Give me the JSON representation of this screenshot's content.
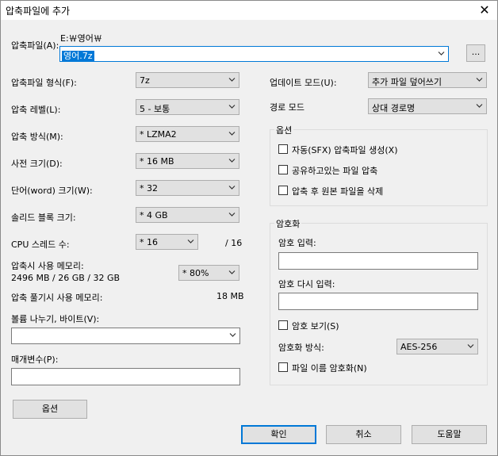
{
  "dialog": {
    "title": "압축파일에 추가",
    "close_glyph": "✕"
  },
  "archive": {
    "label": "압축파일(A):",
    "folder": "E:￦영어￦",
    "filename": "영어.7z",
    "browse_label": "..."
  },
  "left": {
    "format": {
      "label": "압축파일 형식(F):",
      "value": "7z"
    },
    "level": {
      "label": "압축 레벨(L):",
      "value": "5 - 보통"
    },
    "method": {
      "label": "압축 방식(M):",
      "value": "* LZMA2"
    },
    "dict": {
      "label": "사전 크기(D):",
      "value": "* 16 MB"
    },
    "word": {
      "label": "단어(word) 크기(W):",
      "value": "* 32"
    },
    "solid": {
      "label": "솔리드 블록 크기:",
      "value": "* 4 GB"
    },
    "threads": {
      "label": "CPU 스레드 수:",
      "value": "* 16",
      "total": "/ 16"
    },
    "memory": {
      "label": "압축시 사용 메모리:",
      "detail": "2496 MB / 26 GB / 32 GB",
      "value": "* 80%"
    },
    "decomp": {
      "label": "압축 풀기시 사용 메모리:",
      "value": "18 MB"
    },
    "split": {
      "label": "볼륨 나누기, 바이트(V):",
      "value": ""
    },
    "params": {
      "label": "매개변수(P):",
      "value": ""
    },
    "options_button": "옵션"
  },
  "right": {
    "update": {
      "label": "업데이트 모드(U):",
      "value": "추가 파일 덮어쓰기"
    },
    "path": {
      "label": "경로 모드",
      "value": "상대 경로명"
    },
    "options_group": {
      "title": "옵션",
      "sfx": "자동(SFX) 압축파일 생성(X)",
      "shared": "공유하고있는 파일 압축",
      "delete": "압축 후 원본 파일을 삭제"
    },
    "encryption": {
      "title": "암호화",
      "enter": "암호 입력:",
      "reenter": "암호 다시 입력:",
      "show": "암호 보기(S)",
      "method_label": "암호화 방식:",
      "method_value": "AES-256",
      "encrypt_names": "파일 이름 암호화(N)"
    }
  },
  "buttons": {
    "ok": "확인",
    "cancel": "취소",
    "help": "도움말"
  },
  "colors": {
    "accent": "#0078d7",
    "background": "#f0f0f0"
  }
}
